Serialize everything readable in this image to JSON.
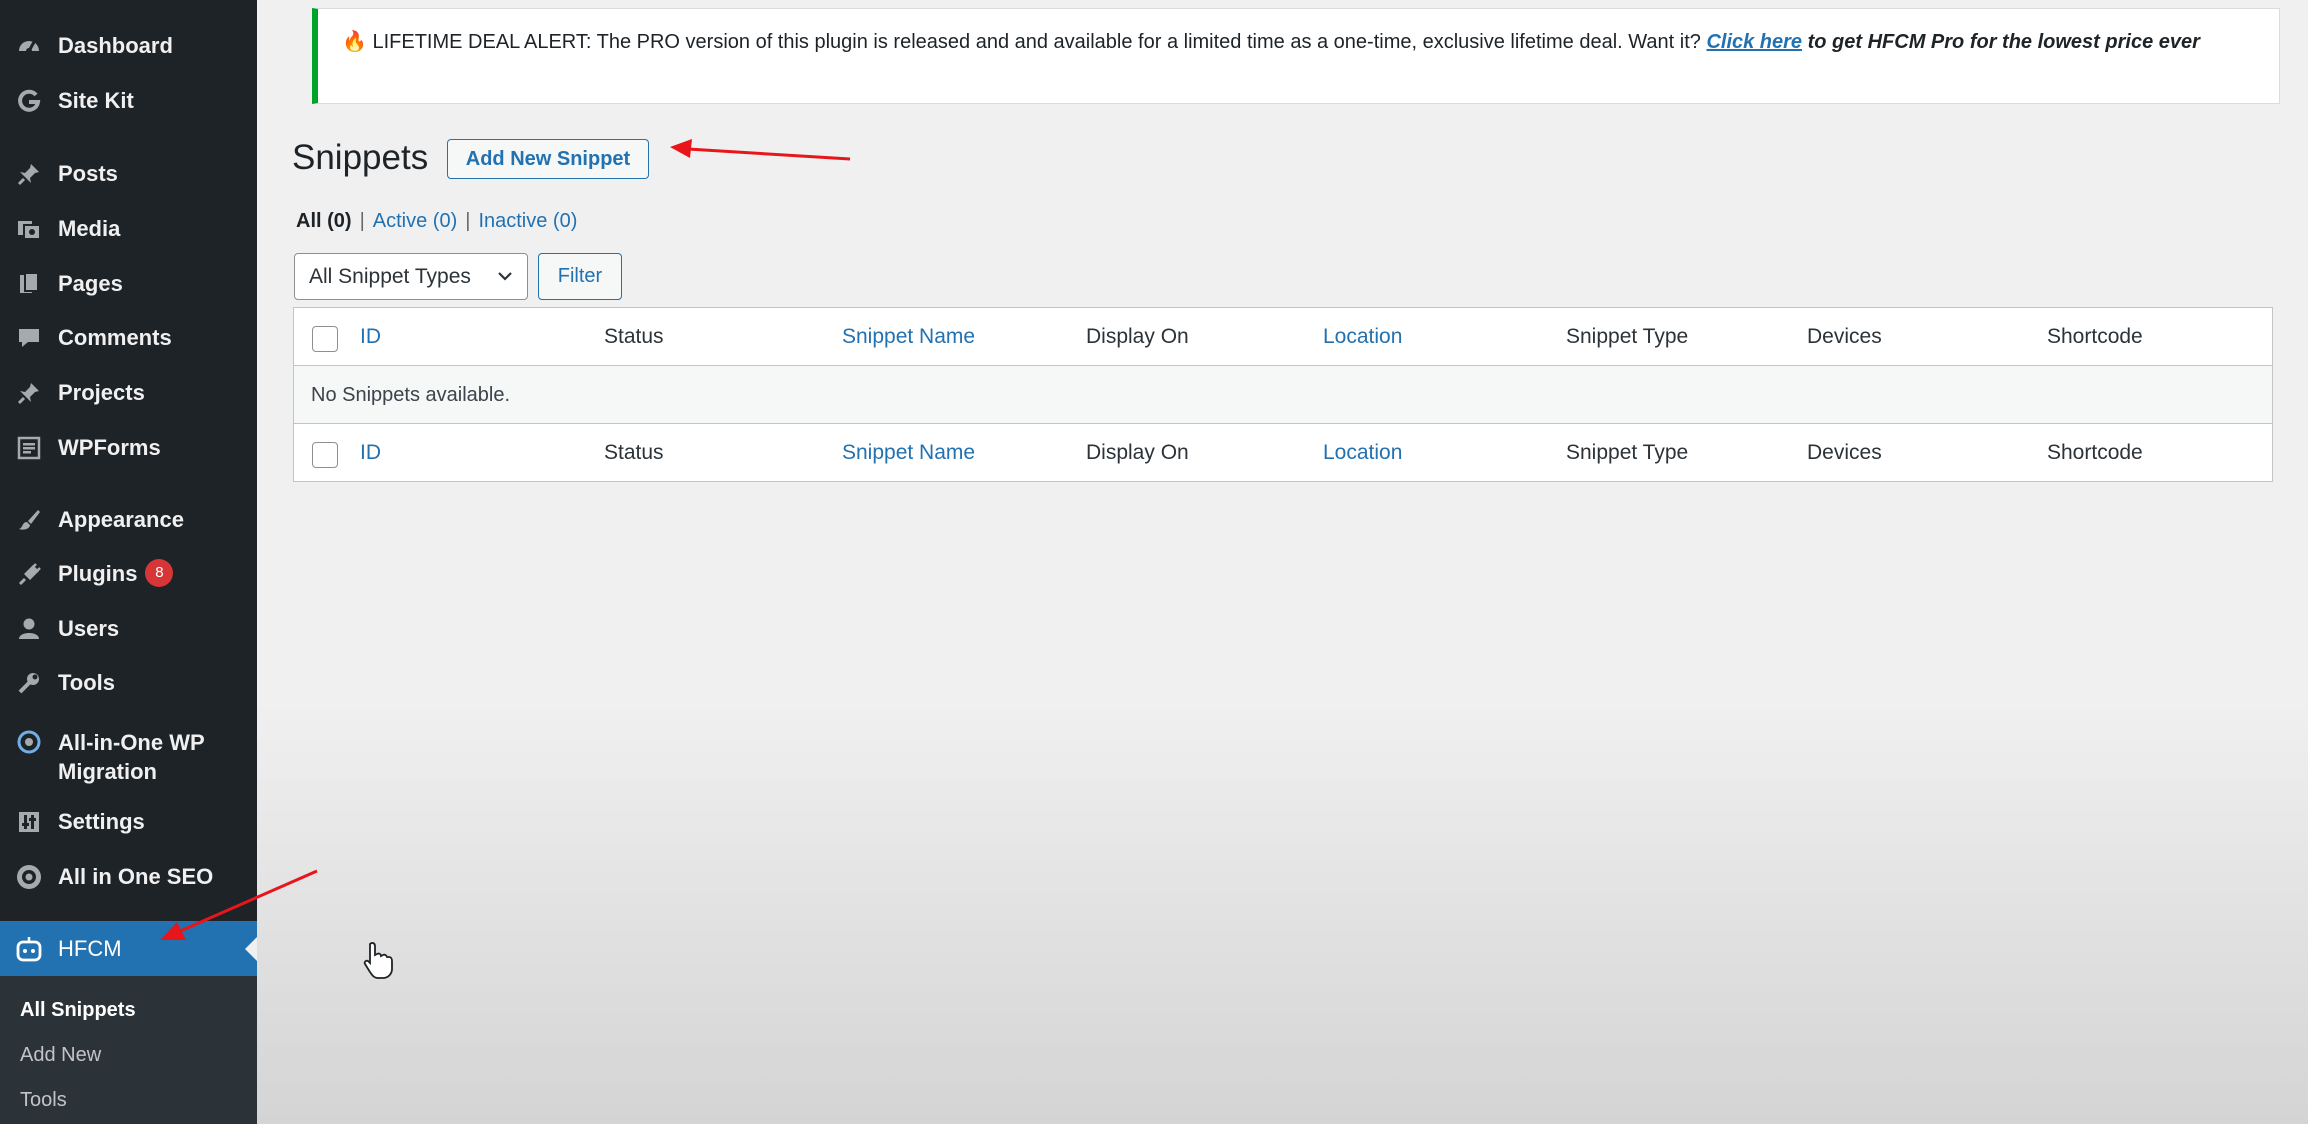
{
  "sidebar": {
    "items": [
      {
        "label": "Dashboard",
        "icon": "dashboard-icon"
      },
      {
        "label": "Site Kit",
        "icon": "google-g-icon"
      },
      {
        "label": "Posts",
        "icon": "pushpin-icon"
      },
      {
        "label": "Media",
        "icon": "media-icon"
      },
      {
        "label": "Pages",
        "icon": "pages-icon"
      },
      {
        "label": "Comments",
        "icon": "comment-icon"
      },
      {
        "label": "Projects",
        "icon": "pushpin-icon"
      },
      {
        "label": "WPForms",
        "icon": "form-icon"
      },
      {
        "label": "Appearance",
        "icon": "paintbrush-icon"
      },
      {
        "label": "Plugins",
        "icon": "plugin-icon",
        "badge": "8"
      },
      {
        "label": "Users",
        "icon": "user-icon"
      },
      {
        "label": "Tools",
        "icon": "wrench-icon"
      },
      {
        "label": "All-in-One WP Migration",
        "icon": "migration-icon"
      },
      {
        "label": "Settings",
        "icon": "settings-icon"
      },
      {
        "label": "All in One SEO",
        "icon": "seo-gear-icon"
      },
      {
        "label": "HFCM",
        "icon": "robot-icon",
        "current": true
      }
    ],
    "submenu": [
      {
        "label": "All Snippets",
        "active": true
      },
      {
        "label": "Add New"
      },
      {
        "label": "Tools"
      }
    ]
  },
  "notice": {
    "icon": "fire-icon",
    "text": "LIFETIME DEAL ALERT: The PRO version of this plugin is released and and available for a limited time as a one-time, exclusive lifetime deal. Want it?",
    "link_text": "Click here",
    "tail": "to get HFCM Pro for the lowest price ever"
  },
  "page": {
    "title": "Snippets",
    "add_new_label": "Add New Snippet"
  },
  "views": {
    "all": "All (0)",
    "active": "Active (0)",
    "inactive": "Inactive (0)",
    "separator": "|"
  },
  "filters": {
    "type_selected": "All Snippet Types",
    "filter_label": "Filter"
  },
  "table": {
    "columns": [
      "ID",
      "Status",
      "Snippet Name",
      "Display On",
      "Location",
      "Snippet Type",
      "Devices",
      "Shortcode"
    ],
    "empty_message": "No Snippets available."
  },
  "colors": {
    "sidebar_bg": "#1d2327",
    "accent": "#2271b1",
    "notice_border": "#00a32a",
    "badge": "#d63638",
    "annotation_arrow": "#e8161b"
  }
}
